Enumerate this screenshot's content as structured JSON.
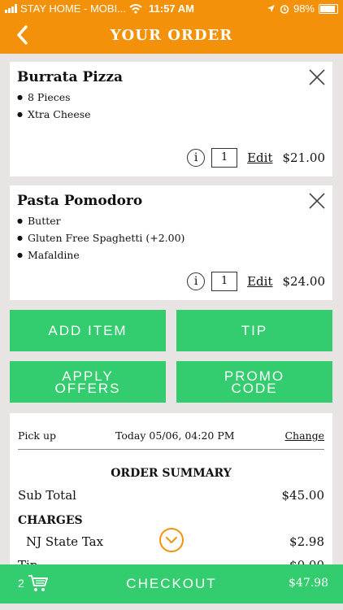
{
  "status_bar": {
    "carrier": "STAY HOME - MOBI...",
    "time": "11:57 AM",
    "battery": "98%"
  },
  "header": {
    "title": "YOUR ORDER"
  },
  "items": [
    {
      "name": "Burrata Pizza",
      "options": [
        "8 Pieces",
        "Xtra Cheese"
      ],
      "quantity": "1",
      "edit_label": "Edit",
      "price": "$21.00"
    },
    {
      "name": "Pasta Pomodoro",
      "options": [
        "Butter",
        "Gluten Free Spaghetti (+2.00)",
        "Mafaldine"
      ],
      "quantity": "1",
      "edit_label": "Edit",
      "price": "$24.00"
    }
  ],
  "actions": {
    "add_item": "ADD ITEM",
    "tip": "TIP",
    "apply_offers_line1": "APPLY",
    "apply_offers_line2": "OFFERS",
    "promo_code_line1": "PROMO",
    "promo_code_line2": "CODE"
  },
  "summary": {
    "pickup_label": "Pick up",
    "pickup_time": "Today 05/06, 04:20 PM",
    "change_label": "Change",
    "title": "ORDER SUMMARY",
    "subtotal_label": "Sub Total",
    "subtotal_value": "$45.00",
    "charges_label": "CHARGES",
    "tax_label": "NJ State Tax",
    "tax_value": "$2.98",
    "tip_label": "Tip",
    "tip_value": "$0.00"
  },
  "checkout": {
    "cart_count": "2",
    "label": "CHECKOUT",
    "total": "$47.98"
  },
  "colors": {
    "header": "#f3920a",
    "button": "#33cc6e",
    "background": "#e9e4e4"
  }
}
